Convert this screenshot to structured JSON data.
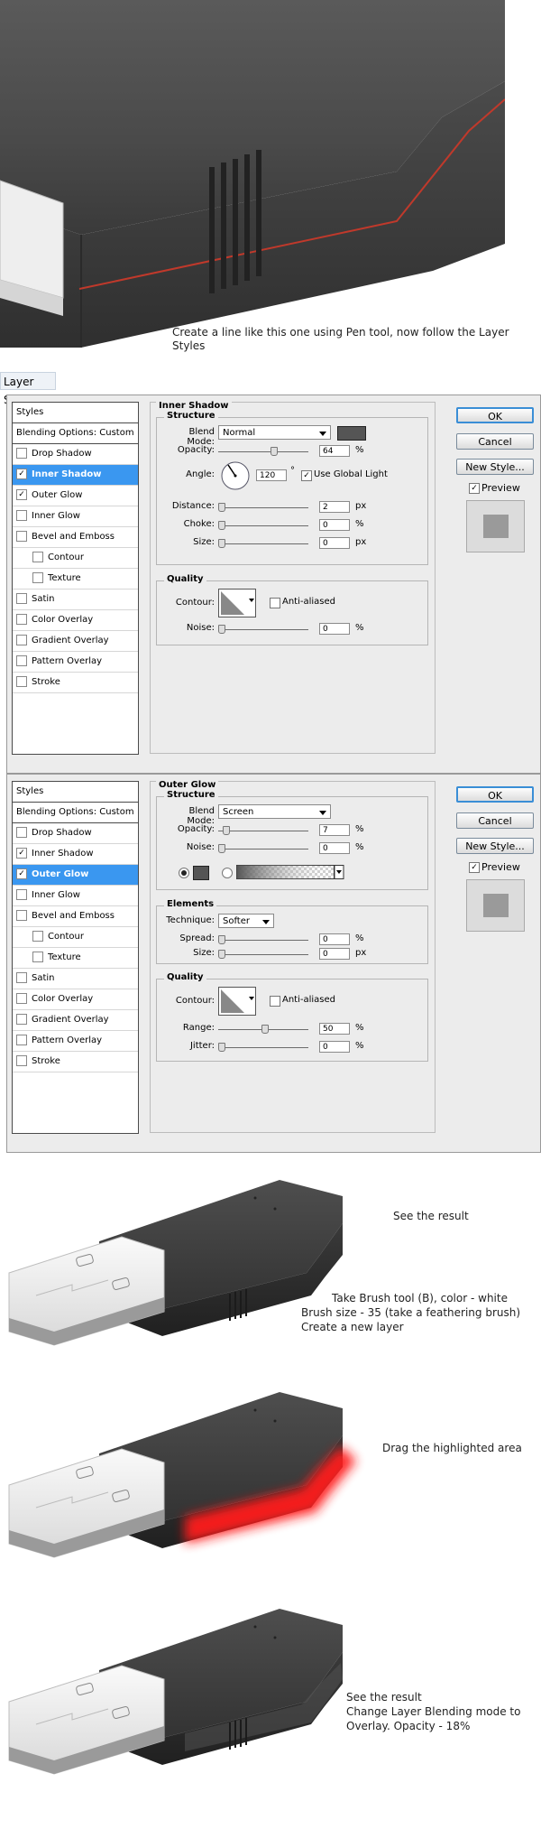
{
  "top_caption": "Create a line like this one using Pen tool, now follow the Layer Styles",
  "tag_label": "Layer Style",
  "styles_panel": {
    "header": "Styles",
    "blending": "Blending Options: Custom",
    "items": [
      "Drop Shadow",
      "Inner Shadow",
      "Outer Glow",
      "Inner Glow",
      "Bevel and Emboss",
      "Contour",
      "Texture",
      "Satin",
      "Color Overlay",
      "Gradient Overlay",
      "Pattern Overlay",
      "Stroke"
    ]
  },
  "buttons": {
    "ok": "OK",
    "cancel": "Cancel",
    "new_style": "New Style...",
    "preview": "Preview"
  },
  "inner_shadow": {
    "title": "Inner Shadow",
    "structure": "Structure",
    "blend_mode_label": "Blend Mode:",
    "blend_mode": "Normal",
    "opacity_label": "Opacity:",
    "opacity": "64",
    "angle_label": "Angle:",
    "angle": "120",
    "degree": "°",
    "global_light": "Use Global Light",
    "distance_label": "Distance:",
    "distance": "2",
    "choke_label": "Choke:",
    "choke": "0",
    "size_label": "Size:",
    "size": "0",
    "quality": "Quality",
    "contour_label": "Contour:",
    "anti_aliased": "Anti-aliased",
    "noise_label": "Noise:",
    "noise": "0",
    "pct": "%",
    "px": "px"
  },
  "outer_glow": {
    "title": "Outer Glow",
    "structure": "Structure",
    "blend_mode_label": "Blend Mode:",
    "blend_mode": "Screen",
    "opacity_label": "Opacity:",
    "opacity": "7",
    "noise_label": "Noise:",
    "noise": "0",
    "elements": "Elements",
    "technique_label": "Technique:",
    "technique": "Softer",
    "spread_label": "Spread:",
    "spread": "0",
    "size_label": "Size:",
    "size": "0",
    "quality": "Quality",
    "contour_label": "Contour:",
    "anti_aliased": "Anti-aliased",
    "range_label": "Range:",
    "range": "50",
    "jitter_label": "Jitter:",
    "jitter": "0",
    "pct": "%",
    "px": "px"
  },
  "captions": {
    "see_result_1": "See the result",
    "brush_1": "Take Brush tool (B), color - white",
    "brush_2": "Brush size - 35 (take a feathering brush)",
    "brush_3": "Create a new layer",
    "drag": "Drag the highlighted area",
    "see_result_2": "See the result",
    "blend_1": "Change Layer Blending mode to",
    "blend_2": "Overlay. Opacity - 18%"
  },
  "colors": {
    "selection": "#3a97f0",
    "plug_dark": "#3c3c3c",
    "highlight_red": "#ff1a1a",
    "guide_line": "#c0392b"
  },
  "icons": [
    "checkbox-icon",
    "dropdown-arrow-icon",
    "angle-dial-icon",
    "contour-icon",
    "gradient-swatch-icon"
  ]
}
